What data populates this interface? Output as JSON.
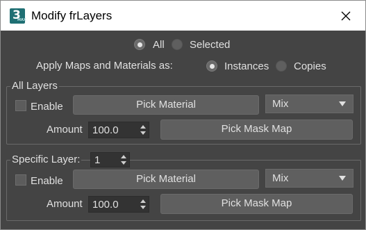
{
  "window": {
    "title": "Modify frLayers",
    "icon_glyph": "3",
    "icon_sub": "MAX",
    "close_icon": "close-icon"
  },
  "selection": {
    "options": [
      "All",
      "Selected"
    ],
    "selected": "All"
  },
  "apply": {
    "label": "Apply Maps and Materials as:",
    "options": [
      "Instances",
      "Copies"
    ],
    "selected": "Instances"
  },
  "all_layers": {
    "group_title": "All Layers",
    "enable_label": "Enable",
    "enable_checked": false,
    "pick_material_label": "Pick Material",
    "mode_value": "Mix",
    "amount_label": "Amount",
    "amount_value": "100.0",
    "pick_mask_label": "Pick Mask Map"
  },
  "specific_layer": {
    "group_title": "Specific Layer:",
    "layer_value": "1",
    "enable_label": "Enable",
    "enable_checked": false,
    "pick_material_label": "Pick Material",
    "mode_value": "Mix",
    "amount_label": "Amount",
    "amount_value": "100.0",
    "pick_mask_label": "Pick Mask Map"
  },
  "colors": {
    "panel_bg": "#444444",
    "control_bg": "#5f5f5f",
    "field_bg": "#333333",
    "text": "#e0e0e0",
    "titlebar_bg": "#ffffff",
    "icon_teal": "#1f6f73"
  }
}
